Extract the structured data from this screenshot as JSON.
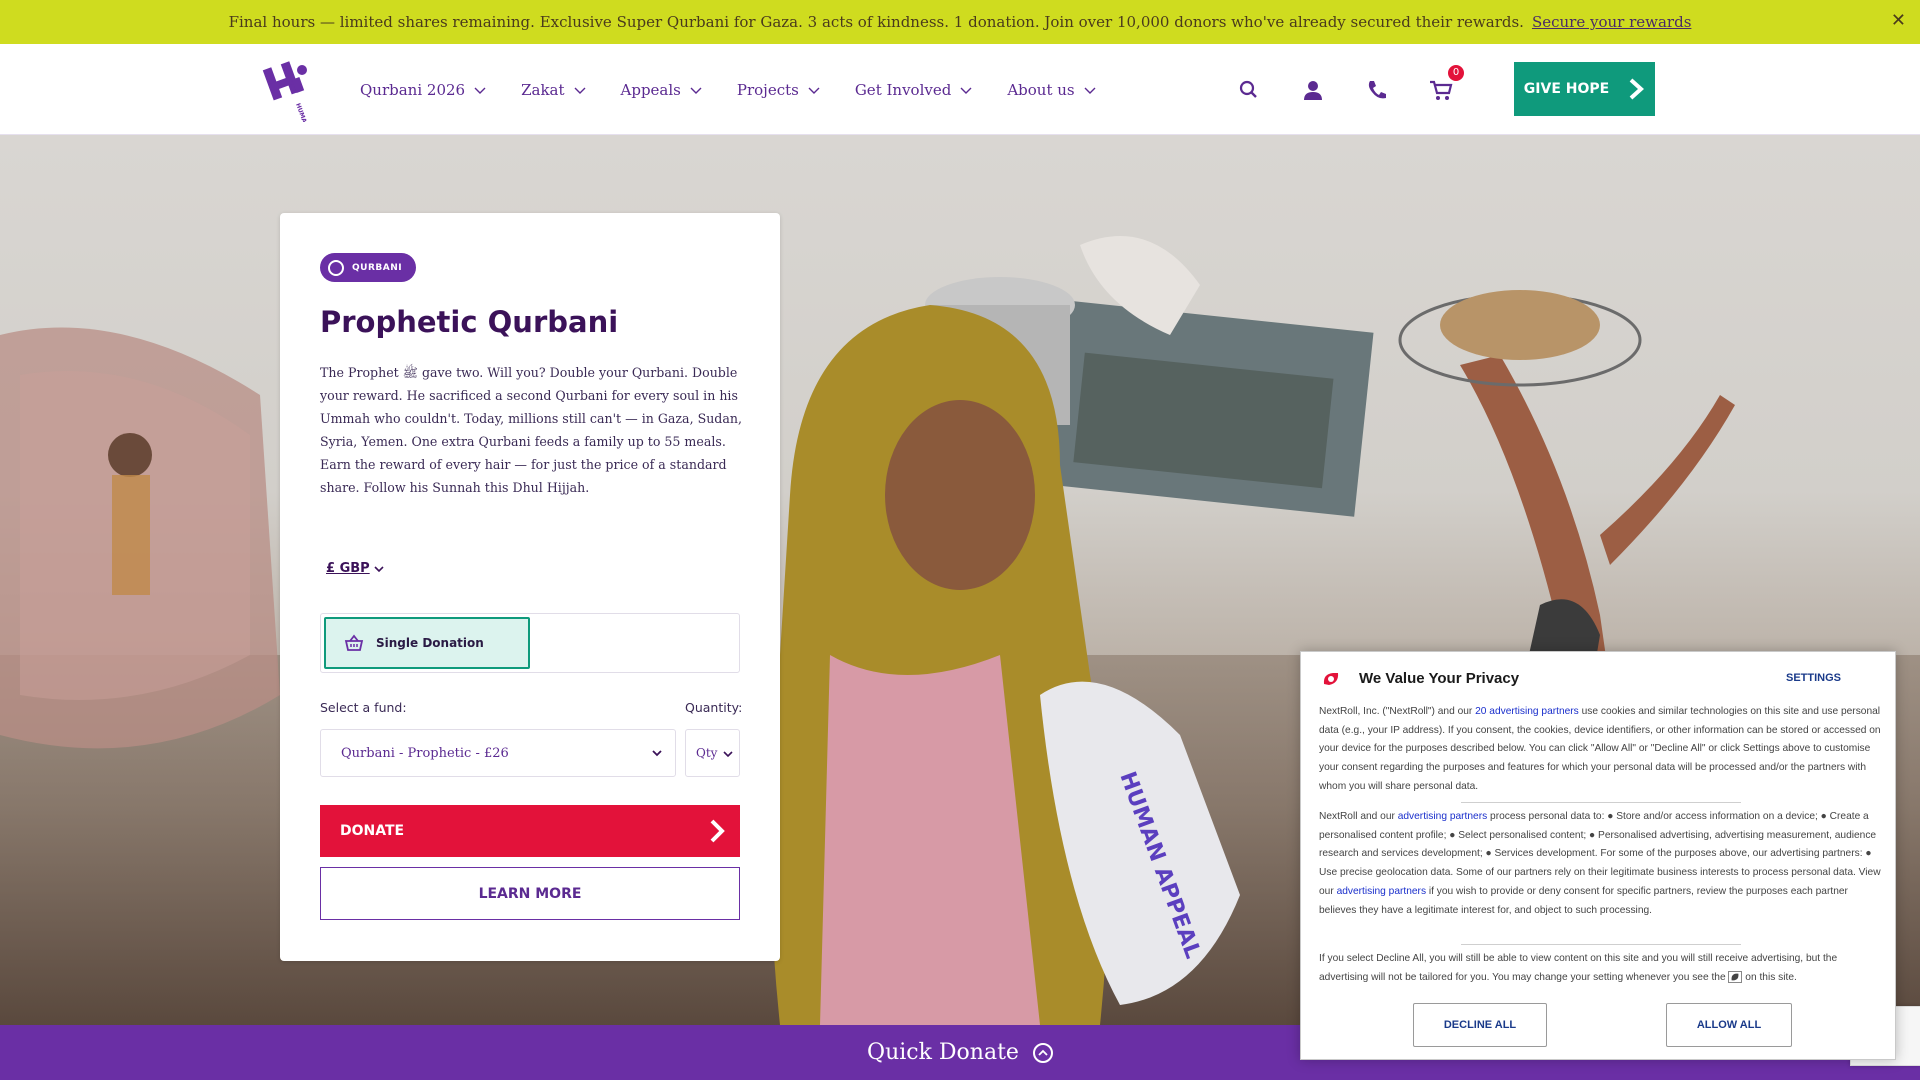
{
  "banner": {
    "text": "Final hours — limited shares remaining. Exclusive Super Qurbani for Gaza. 3 acts of kindness. 1 donation. Join over 10,000 donors who've already secured their rewards.",
    "link": "Secure your rewards",
    "close": "✕",
    "color": "#cfdc1f"
  },
  "header": {
    "logo_text": "HUMAN APPEAL",
    "nav": [
      {
        "label": "Qurbani 2026"
      },
      {
        "label": "Zakat"
      },
      {
        "label": "Appeals"
      },
      {
        "label": "Projects"
      },
      {
        "label": "Get Involved"
      },
      {
        "label": "About us"
      }
    ],
    "icons": [
      "search-icon",
      "user-icon",
      "phone-icon",
      "cart-icon"
    ],
    "cart_count": "0",
    "give_hope": "GIVE HOPE",
    "accent": "#0f9a7c"
  },
  "card": {
    "badge": "QURBANI",
    "title": "Prophetic Qurbani",
    "description": "The Prophet ﷺ gave two. Will you? Double your Qurbani. Double your reward. He sacrificed a second Qurbani for every soul in his Ummah who couldn't. Today, millions still can't — in Gaza, Sudan, Syria, Yemen. One extra Qurbani feeds a family up to 55 meals. Earn the reward of every hair — for just the price of a standard share. Follow his Sunnah this Dhul Hijjah.",
    "currency": "£ GBP",
    "donation_type": "Single Donation",
    "fund_label": "Select a fund:",
    "quantity_label": "Quantity:",
    "fund_value": "Qurbani - Prophetic - £26",
    "qty_placeholder": "Qty",
    "donate": "DONATE",
    "learn_more": "LEARN MORE",
    "donate_color": "#e3123a",
    "brand_color": "#6a2fa5"
  },
  "hero": {
    "bag_text": "HUMAN APPEAL"
  },
  "quick_donate": {
    "label": "Quick Donate"
  },
  "privacy": {
    "title": "We Value Your Privacy",
    "settings": "SETTINGS",
    "p1_a": "NextRoll, Inc. (\"NextRoll\") and our ",
    "p1_link": "20 advertising partners",
    "p1_b": " use cookies and similar technologies on this site and use personal data (e.g., your IP address). If you consent, the cookies, device identifiers, or other information can be stored or accessed on your device for the purposes described below. You can click \"Allow All\" or \"Decline All\" or click Settings above to customise your consent regarding the purposes and features for which your personal data will be processed and/or the partners with whom you will share personal data.",
    "p2_a": "NextRoll and our ",
    "p2_link1": "advertising partners",
    "p2_b": " process personal data to: ● Store and/or access information on a device; ● Create a personalised content profile; ● Select personalised content; ● Personalised advertising, advertising measurement, audience research and services development; ● Services development. For some of the purposes above, our advertising partners: ● Use precise geolocation data. Some of our partners rely on their legitimate business interests to process personal data. View our ",
    "p2_link2": "advertising partners",
    "p2_c": " if you wish to provide or deny consent for specific partners, review the purposes each partner believes they have a legitimate interest for, and object to such processing.",
    "p3_a": "If you select Decline All, you will still be able to view content on this site and you will still receive advertising, but the advertising will not be tailored for you. You may change your setting whenever you see the ",
    "p3_b": " on this site.",
    "decline": "DECLINE ALL",
    "allow": "ALLOW ALL"
  }
}
